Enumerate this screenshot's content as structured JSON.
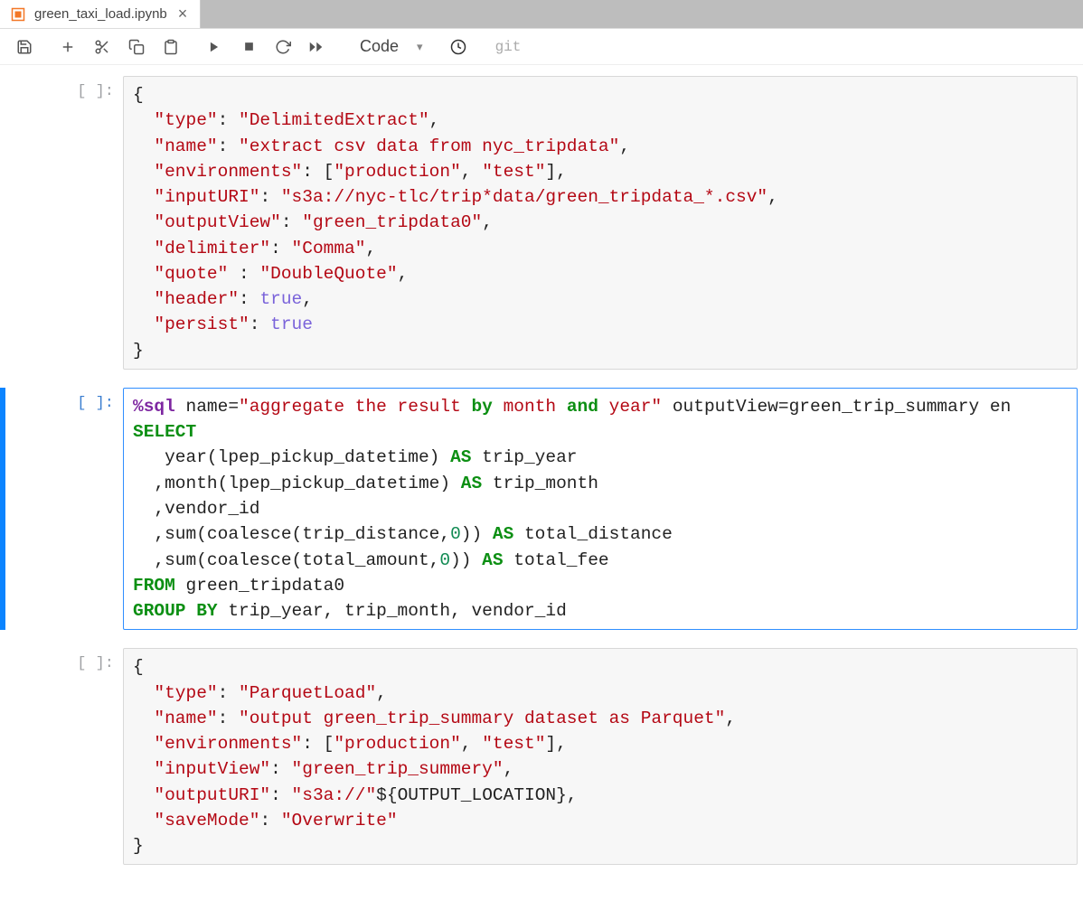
{
  "tab": {
    "filename": "green_taxi_load.ipynb"
  },
  "toolbar": {
    "cell_type": "Code",
    "git_label": "git"
  },
  "cells": [
    {
      "prompt": "[ ]:"
    },
    {
      "prompt": "[ ]:"
    },
    {
      "prompt": "[ ]:"
    }
  ],
  "cell1": {
    "open": "{",
    "k_type": "\"type\"",
    "v_type": "\"DelimitedExtract\"",
    "k_name": "\"name\"",
    "v_name": "\"extract csv data from nyc_tripdata\"",
    "k_env": "\"environments\"",
    "v_env_a": "\"production\"",
    "v_env_b": "\"test\"",
    "k_inputURI": "\"inputURI\"",
    "v_inputURI": "\"s3a://nyc-tlc/trip*data/green_tripdata_*.csv\"",
    "k_outputView": "\"outputView\"",
    "v_outputView": "\"green_tripdata0\"",
    "k_delimiter": "\"delimiter\"",
    "v_delimiter": "\"Comma\"",
    "k_quote": "\"quote\"",
    "v_quote": "\"DoubleQuote\"",
    "k_header": "\"header\"",
    "v_header": "true",
    "k_persist": "\"persist\"",
    "v_persist": "true",
    "close": "}"
  },
  "cell2": {
    "magic": "%sql",
    "name_attr_label": " name=",
    "name_attr_val": "\"aggregate the result ",
    "by": "by",
    "mid1": " month ",
    "and": "and",
    "mid2": " year\"",
    "rest_attrs": " outputView=green_trip_summary en",
    "select": "SELECT",
    "l_year": "   year(lpep_pickup_datetime) ",
    "as1": "AS",
    "a_year": " trip_year",
    "l_month": "  ,month(lpep_pickup_datetime) ",
    "as2": "AS",
    "a_month": " trip_month",
    "l_vendor": "  ,vendor_id",
    "l_sum1a": "  ,sum(coalesce(trip_distance,",
    "zero1": "0",
    "l_sum1b": ")) ",
    "as3": "AS",
    "a_sum1": " total_distance",
    "l_sum2a": "  ,sum(coalesce(total_amount,",
    "zero2": "0",
    "l_sum2b": ")) ",
    "as4": "AS",
    "a_sum2": " total_fee",
    "from": "FROM",
    "from_tbl": " green_tripdata0",
    "groupby": "GROUP BY",
    "groupby_cols": " trip_year, trip_month, vendor_id"
  },
  "cell3": {
    "open": "{",
    "k_type": "\"type\"",
    "v_type": "\"ParquetLoad\"",
    "k_name": "\"name\"",
    "v_name": "\"output green_trip_summary dataset as Parquet\"",
    "k_env": "\"environments\"",
    "v_env_a": "\"production\"",
    "v_env_b": "\"test\"",
    "k_inputView": "\"inputView\"",
    "v_inputView": "\"green_trip_summery\"",
    "k_outputURI": "\"outputURI\"",
    "v_outputURI_a": "\"s3a://\"",
    "v_outputURI_b": "${OUTPUT_LOCATION},",
    "k_saveMode": "\"saveMode\"",
    "v_saveMode": "\"Overwrite\"",
    "close": "}"
  }
}
